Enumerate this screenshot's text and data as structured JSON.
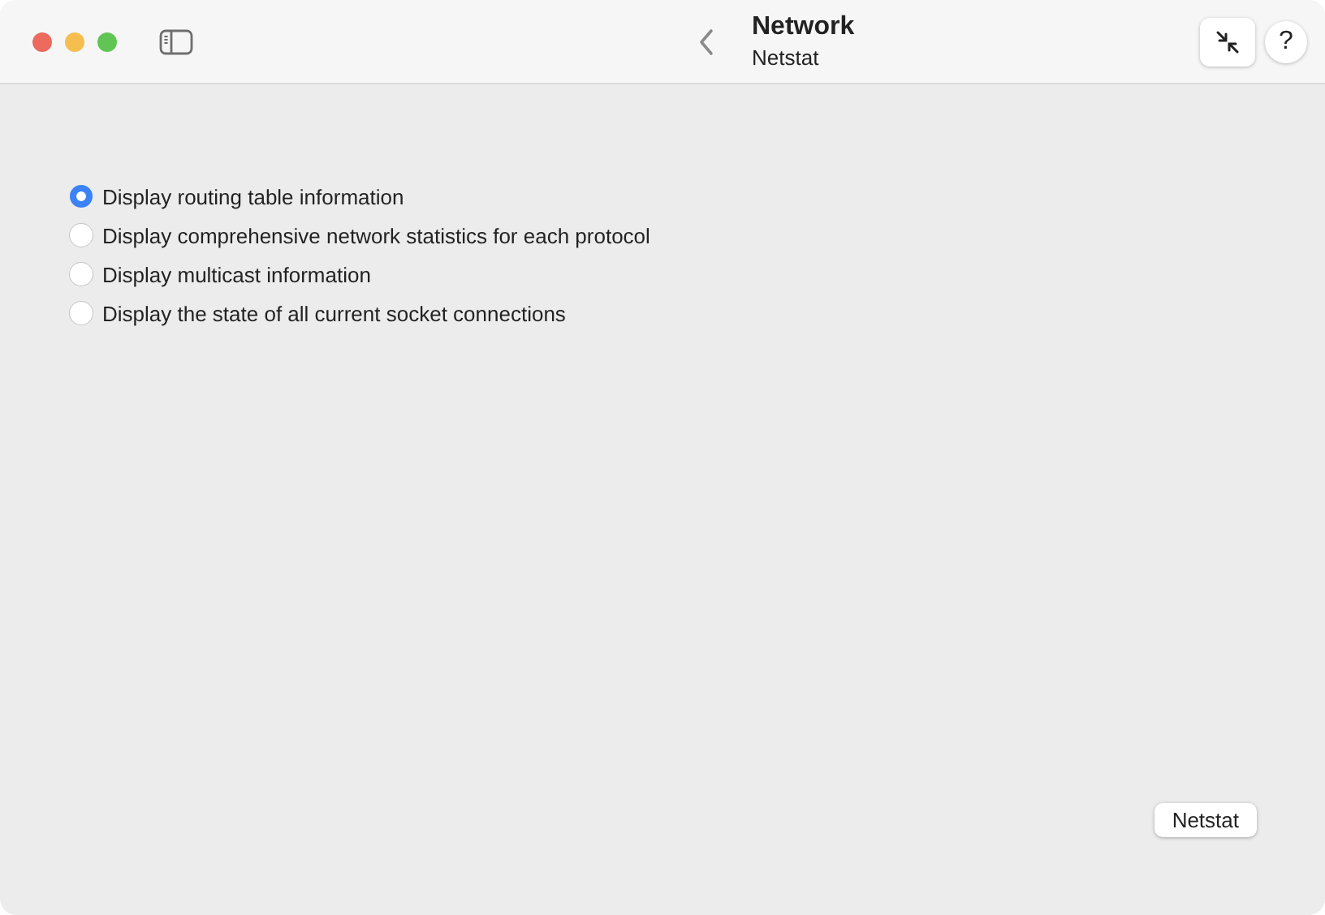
{
  "window": {
    "title": "Network",
    "subtitle": "Netstat"
  },
  "options": [
    {
      "label": "Display routing table information",
      "selected": true
    },
    {
      "label": "Display comprehensive network statistics for each protocol",
      "selected": false
    },
    {
      "label": "Display multicast information",
      "selected": false
    },
    {
      "label": "Display the state of all current socket connections",
      "selected": false
    }
  ],
  "help_button": "?",
  "action_button": "Netstat"
}
